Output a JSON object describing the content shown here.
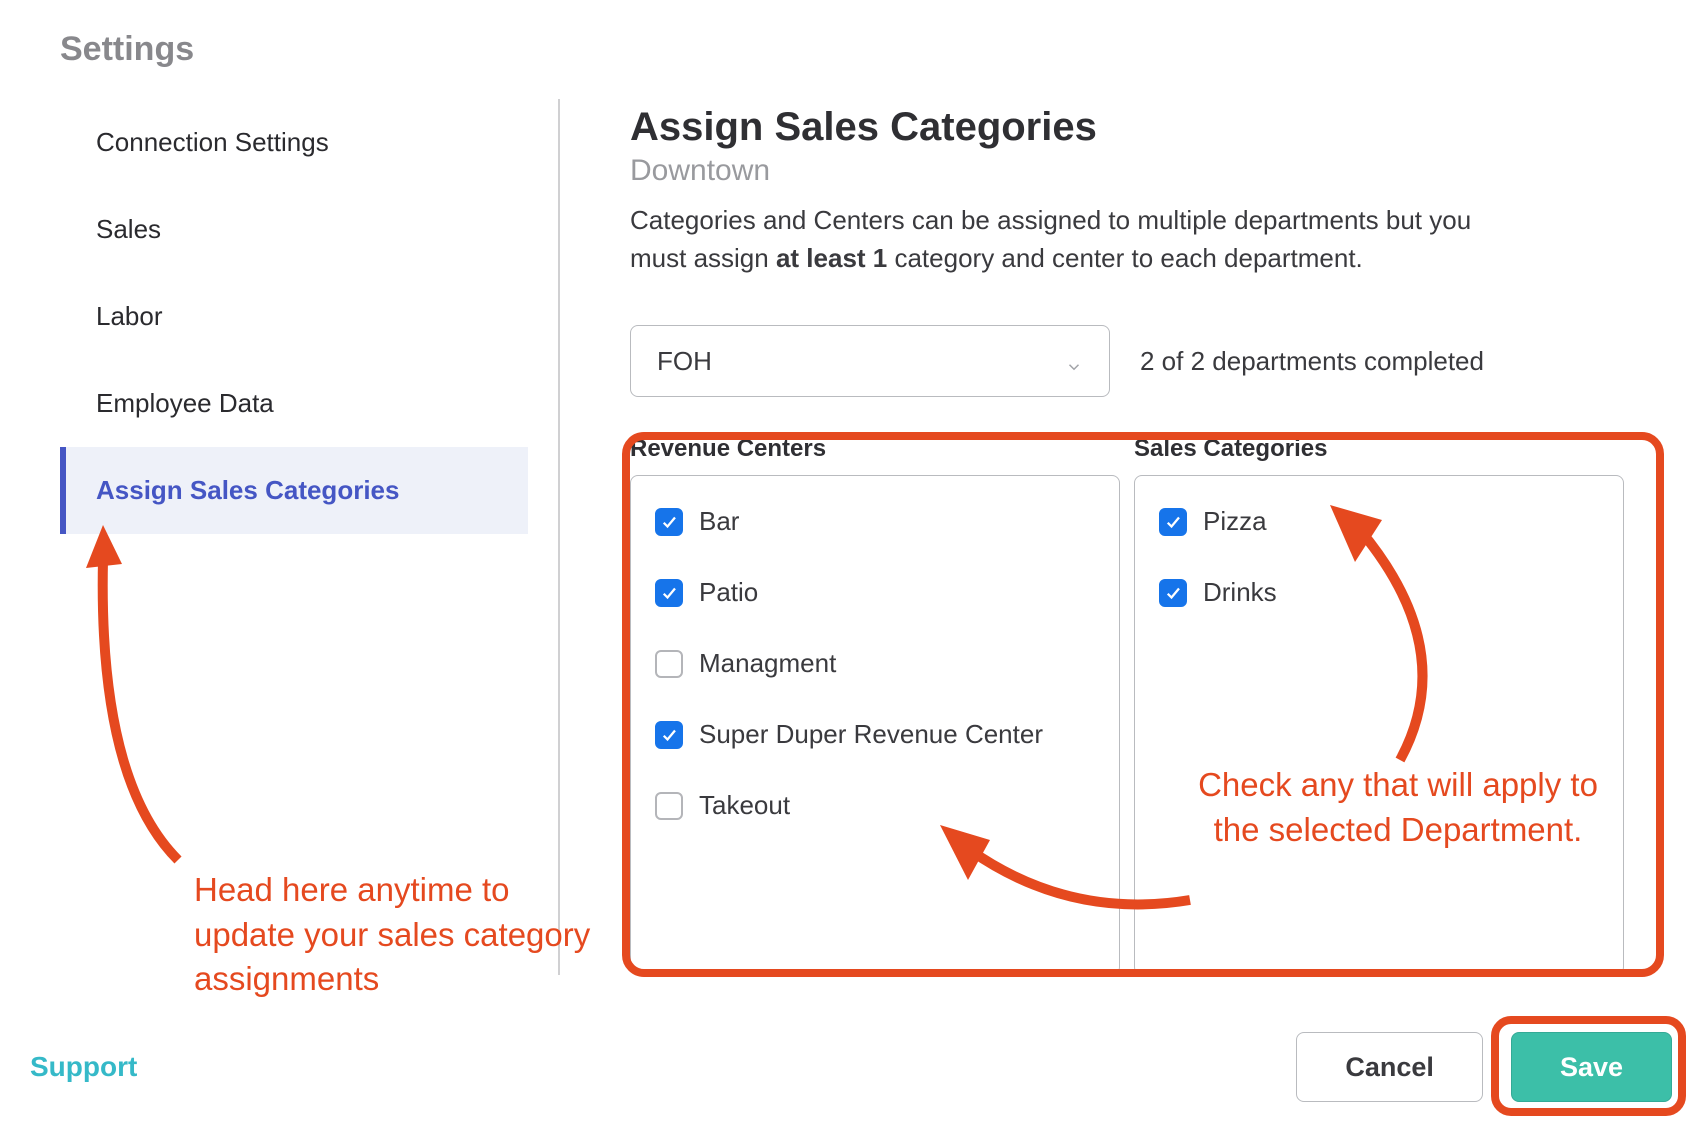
{
  "page": {
    "title": "Settings"
  },
  "sidebar": {
    "items": [
      {
        "label": "Connection Settings"
      },
      {
        "label": "Sales"
      },
      {
        "label": "Labor"
      },
      {
        "label": "Employee Data"
      },
      {
        "label": "Assign Sales Categories"
      }
    ]
  },
  "content": {
    "title": "Assign Sales Categories",
    "subtitle": "Downtown",
    "desc_pre": "Categories and Centers can be assigned to multiple departments but you must assign ",
    "desc_bold": "at least 1",
    "desc_post": " category and center to each department."
  },
  "department": {
    "selected": "FOH",
    "status": "2 of 2 departments completed"
  },
  "revenue": {
    "header": "Revenue Centers",
    "items": [
      {
        "label": "Bar",
        "checked": true
      },
      {
        "label": "Patio",
        "checked": true
      },
      {
        "label": "Managment",
        "checked": false
      },
      {
        "label": "Super Duper Revenue Center",
        "checked": true
      },
      {
        "label": "Takeout",
        "checked": false
      }
    ]
  },
  "sales": {
    "header": "Sales Categories",
    "items": [
      {
        "label": "Pizza",
        "checked": true
      },
      {
        "label": "Drinks",
        "checked": true
      }
    ]
  },
  "footer": {
    "support": "Support",
    "cancel": "Cancel",
    "save": "Save"
  },
  "annotations": {
    "left": "Head here anytime to update your sales category assignments",
    "right": "Check any that will apply to the selected Department."
  }
}
